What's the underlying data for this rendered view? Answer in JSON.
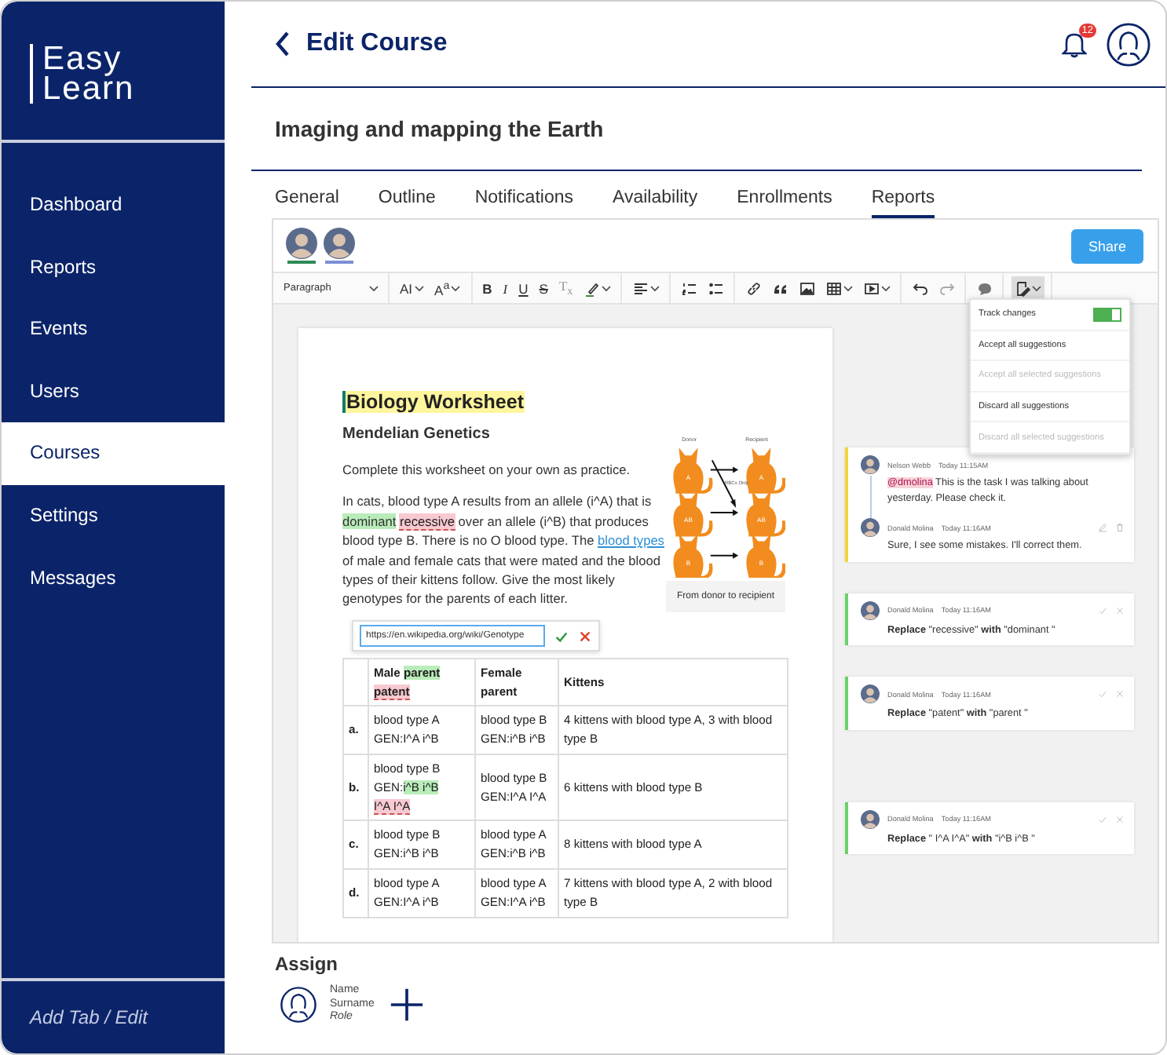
{
  "sidebar": {
    "logo": [
      "Easy",
      "Learn"
    ],
    "items": [
      {
        "label": "Dashboard",
        "selected": false
      },
      {
        "label": "Reports",
        "selected": false
      },
      {
        "label": "Events",
        "selected": false
      },
      {
        "label": "Users",
        "selected": false
      },
      {
        "label": "Courses",
        "selected": true
      },
      {
        "label": "Settings",
        "selected": false
      },
      {
        "label": "Messages",
        "selected": false
      }
    ],
    "footer": "Add Tab / Edit"
  },
  "header": {
    "title": "Edit Course",
    "notifications": "12"
  },
  "course_title": "Imaging and mapping the Earth",
  "tabs": [
    {
      "label": "General",
      "selected": false
    },
    {
      "label": "Outline",
      "selected": false
    },
    {
      "label": "Notifications",
      "selected": false
    },
    {
      "label": "Availability",
      "selected": false
    },
    {
      "label": "Enrollments",
      "selected": false
    },
    {
      "label": "Reports",
      "selected": true
    }
  ],
  "editor": {
    "collaborators": [
      {
        "color": "#2e8b57"
      },
      {
        "color": "#7b8fd6"
      }
    ],
    "share": "Share",
    "toolbar": [
      [
        {
          "kind": "select",
          "label": "Paragraph",
          "caret": true,
          "active": false,
          "disabled": false
        }
      ],
      [
        {
          "kind": "fontsize",
          "glyph": "AI",
          "caret": true,
          "active": false,
          "disabled": false
        },
        {
          "kind": "fontfamily",
          "glyph": "A$^{a}$",
          "caret": true,
          "active": false,
          "disabled": false
        }
      ],
      [
        {
          "kind": "bold",
          "glyph": "B",
          "caret": false,
          "active": false,
          "disabled": false
        },
        {
          "kind": "italic",
          "glyph": "I",
          "caret": false,
          "active": false,
          "disabled": false
        },
        {
          "kind": "underline",
          "glyph": "U",
          "caret": false,
          "active": false,
          "disabled": false
        },
        {
          "kind": "strike",
          "glyph": "S",
          "caret": false,
          "active": false,
          "disabled": false
        },
        {
          "kind": "clearformat",
          "glyph": "T$_{x}$",
          "caret": false,
          "active": false,
          "disabled": false
        },
        {
          "kind": "highlight",
          "caret": true,
          "active": false,
          "disabled": false
        }
      ],
      [
        {
          "kind": "align",
          "caret": true,
          "active": false,
          "disabled": false
        }
      ],
      [
        {
          "kind": "numberedlist",
          "caret": false,
          "active": false,
          "disabled": false
        },
        {
          "kind": "bulletlist",
          "caret": false,
          "active": false,
          "disabled": false
        }
      ],
      [
        {
          "kind": "link",
          "caret": false,
          "active": false,
          "disabled": false
        },
        {
          "kind": "quote",
          "caret": false,
          "active": false,
          "disabled": false
        },
        {
          "kind": "image",
          "caret": false,
          "active": false,
          "disabled": false
        },
        {
          "kind": "table",
          "caret": true,
          "active": false,
          "disabled": false
        },
        {
          "kind": "media",
          "caret": true,
          "active": false,
          "disabled": false
        }
      ],
      [
        {
          "kind": "undo",
          "caret": false,
          "active": false,
          "disabled": false
        },
        {
          "kind": "redo",
          "caret": false,
          "active": false,
          "disabled": true
        }
      ],
      [
        {
          "kind": "comment",
          "caret": false,
          "active": false,
          "disabled": false
        }
      ],
      [
        {
          "kind": "trackchanges",
          "caret": true,
          "active": true,
          "disabled": false
        }
      ]
    ],
    "menu": [
      {
        "kind": "toggle",
        "label": "Track changes",
        "on": true,
        "disabled": false
      },
      {
        "kind": "action",
        "label": "Accept all suggestions",
        "disabled": false
      },
      {
        "kind": "action",
        "label": "Accept all selected suggestions",
        "disabled": true
      },
      {
        "kind": "action",
        "label": "Discard all suggestions",
        "disabled": false
      },
      {
        "kind": "action",
        "label": "Discard all selected suggestions",
        "disabled": true
      }
    ],
    "document": {
      "title": "Biology Worksheet",
      "subtitle": "Mendelian Genetics",
      "figure": {
        "donor": "Donor",
        "recipient": "Recipient",
        "note": "RBCs Only",
        "rows": [
          [
            "A",
            "A"
          ],
          [
            "AB",
            "AB"
          ],
          [
            "B",
            "B"
          ]
        ],
        "caption": "From donor to recipient"
      },
      "paragraphs": [
        [
          {
            "kind": "plain",
            "text": "Complete this worksheet on your own as practice."
          }
        ],
        [
          {
            "kind": "plain",
            "text": "In cats, blood type A results from an allele (i^A) that is "
          },
          {
            "kind": "inserted",
            "text": "dominant"
          },
          {
            "kind": "space"
          },
          {
            "kind": "deleted",
            "text": "recessive"
          },
          {
            "kind": "plain",
            "text": " over an allele (i^B) that produces blood type B. There is no O blood type. The "
          },
          {
            "kind": "link",
            "text": "blood types"
          },
          {
            "kind": "plain",
            "text": " of male and female cats that were mated and the blood types of their kittens follow. Give the most likely genotypes for the parents of each litter."
          }
        ]
      ],
      "link_popup": {
        "value": "https://en.wikipedia.org/wiki/Genotype"
      },
      "table": {
        "columns": [
          {
            "parts": [
              {
                "kind": "plain",
                "text": "Male "
              },
              {
                "kind": "inserted",
                "text": "parent"
              },
              {
                "kind": "space"
              },
              {
                "kind": "deleted",
                "text": "patent"
              }
            ]
          },
          {
            "parts": [
              {
                "kind": "plain",
                "text": "Female parent"
              }
            ]
          },
          {
            "parts": [
              {
                "kind": "plain",
                "text": "Kittens"
              }
            ]
          }
        ],
        "rows": [
          {
            "label": "a.",
            "cells": [
              [
                [
                  {
                    "kind": "plain",
                    "text": "blood type A"
                  }
                ],
                [
                  {
                    "kind": "plain",
                    "text": "GEN:I^A i^B"
                  }
                ]
              ],
              [
                [
                  {
                    "kind": "plain",
                    "text": "blood type B"
                  }
                ],
                [
                  {
                    "kind": "plain",
                    "text": "GEN:i^B i^B"
                  }
                ]
              ],
              [
                [
                  {
                    "kind": "plain",
                    "text": "4 kittens with blood type A, 3 with blood type B"
                  }
                ]
              ]
            ]
          },
          {
            "label": "b.",
            "cells": [
              [
                [
                  {
                    "kind": "plain",
                    "text": "blood type B"
                  }
                ],
                [
                  {
                    "kind": "plain",
                    "text": "GEN:"
                  },
                  {
                    "kind": "inserted",
                    "text": "i^B i^B"
                  },
                  {
                    "kind": "space"
                  },
                  {
                    "kind": "deleted",
                    "text": "I^A I^A"
                  }
                ]
              ],
              [
                [
                  {
                    "kind": "plain",
                    "text": "blood type B"
                  }
                ],
                [
                  {
                    "kind": "plain",
                    "text": "GEN:I^A I^A"
                  }
                ]
              ],
              [
                [
                  {
                    "kind": "plain",
                    "text": "6 kittens with blood type B"
                  }
                ]
              ]
            ]
          },
          {
            "label": "c.",
            "cells": [
              [
                [
                  {
                    "kind": "plain",
                    "text": "blood type B"
                  }
                ],
                [
                  {
                    "kind": "plain",
                    "text": "GEN:i^B i^B"
                  }
                ]
              ],
              [
                [
                  {
                    "kind": "plain",
                    "text": "blood type A"
                  }
                ],
                [
                  {
                    "kind": "plain",
                    "text": "GEN:i^B i^B"
                  }
                ]
              ],
              [
                [
                  {
                    "kind": "plain",
                    "text": "8 kittens with blood type A"
                  }
                ]
              ]
            ]
          },
          {
            "label": "d.",
            "cells": [
              [
                [
                  {
                    "kind": "plain",
                    "text": "blood type A"
                  }
                ],
                [
                  {
                    "kind": "plain",
                    "text": "GEN:I^A i^B"
                  }
                ]
              ],
              [
                [
                  {
                    "kind": "plain",
                    "text": "blood type A"
                  }
                ],
                [
                  {
                    "kind": "plain",
                    "text": "GEN:I^A i^B"
                  }
                ]
              ],
              [
                [
                  {
                    "kind": "plain",
                    "text": "7 kittens with blood type A, 2 with blood type B"
                  }
                ]
              ]
            ]
          }
        ]
      }
    },
    "comments": [
      {
        "kind": "thread",
        "items": [
          {
            "author": "Nelson Webb",
            "time": "Today 11:15AM",
            "actions": false,
            "text": [
              {
                "kind": "mention",
                "text": "@dmolina"
              },
              {
                "kind": "plain",
                "text": " This is the task I was talking about yesterday. Please check it."
              }
            ]
          },
          {
            "author": "Donald Molina",
            "time": "Today 11:16AM",
            "actions": true,
            "text": [
              {
                "kind": "plain",
                "text": "Sure, I see some mistakes. I'll correct them."
              }
            ]
          }
        ]
      },
      {
        "kind": "suggestion",
        "author": "Donald Molina",
        "time": "Today 11:16AM",
        "text": "**Replace** \"recessive\" **with** \"dominant \""
      },
      {
        "kind": "suggestion",
        "author": "Donald Molina",
        "time": "Today 11:16AM",
        "text": "**Replace** \"patent\" **with** \"parent \""
      },
      {
        "kind": "suggestion",
        "author": "Donald Molina",
        "time": "Today 11:16AM",
        "text": "**Replace** \" I^A I^A\" **with** \"i^B i^B \""
      }
    ]
  },
  "assign": {
    "title": "Assign",
    "person": {
      "name": "Name",
      "surname": "Surname",
      "role": "Role"
    }
  }
}
